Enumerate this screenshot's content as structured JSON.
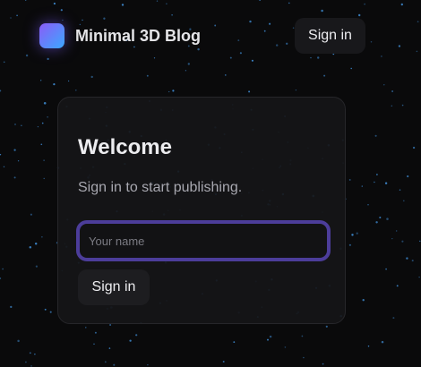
{
  "header": {
    "brand": "Minimal 3D Blog",
    "signin_label": "Sign in"
  },
  "card": {
    "title": "Welcome",
    "subtitle": "Sign in to start publishing.",
    "name_input": {
      "value": "",
      "placeholder": "Your name"
    },
    "signin_label": "Sign in"
  },
  "colors": {
    "background": "#0a0a0b",
    "star": "#3b82c4",
    "accent_focus": "#4c3d9a",
    "logo_gradient_start": "#8b5cf6",
    "logo_gradient_end": "#3ba8ff"
  },
  "icons": {
    "logo": "gradient-square-logo-icon"
  }
}
